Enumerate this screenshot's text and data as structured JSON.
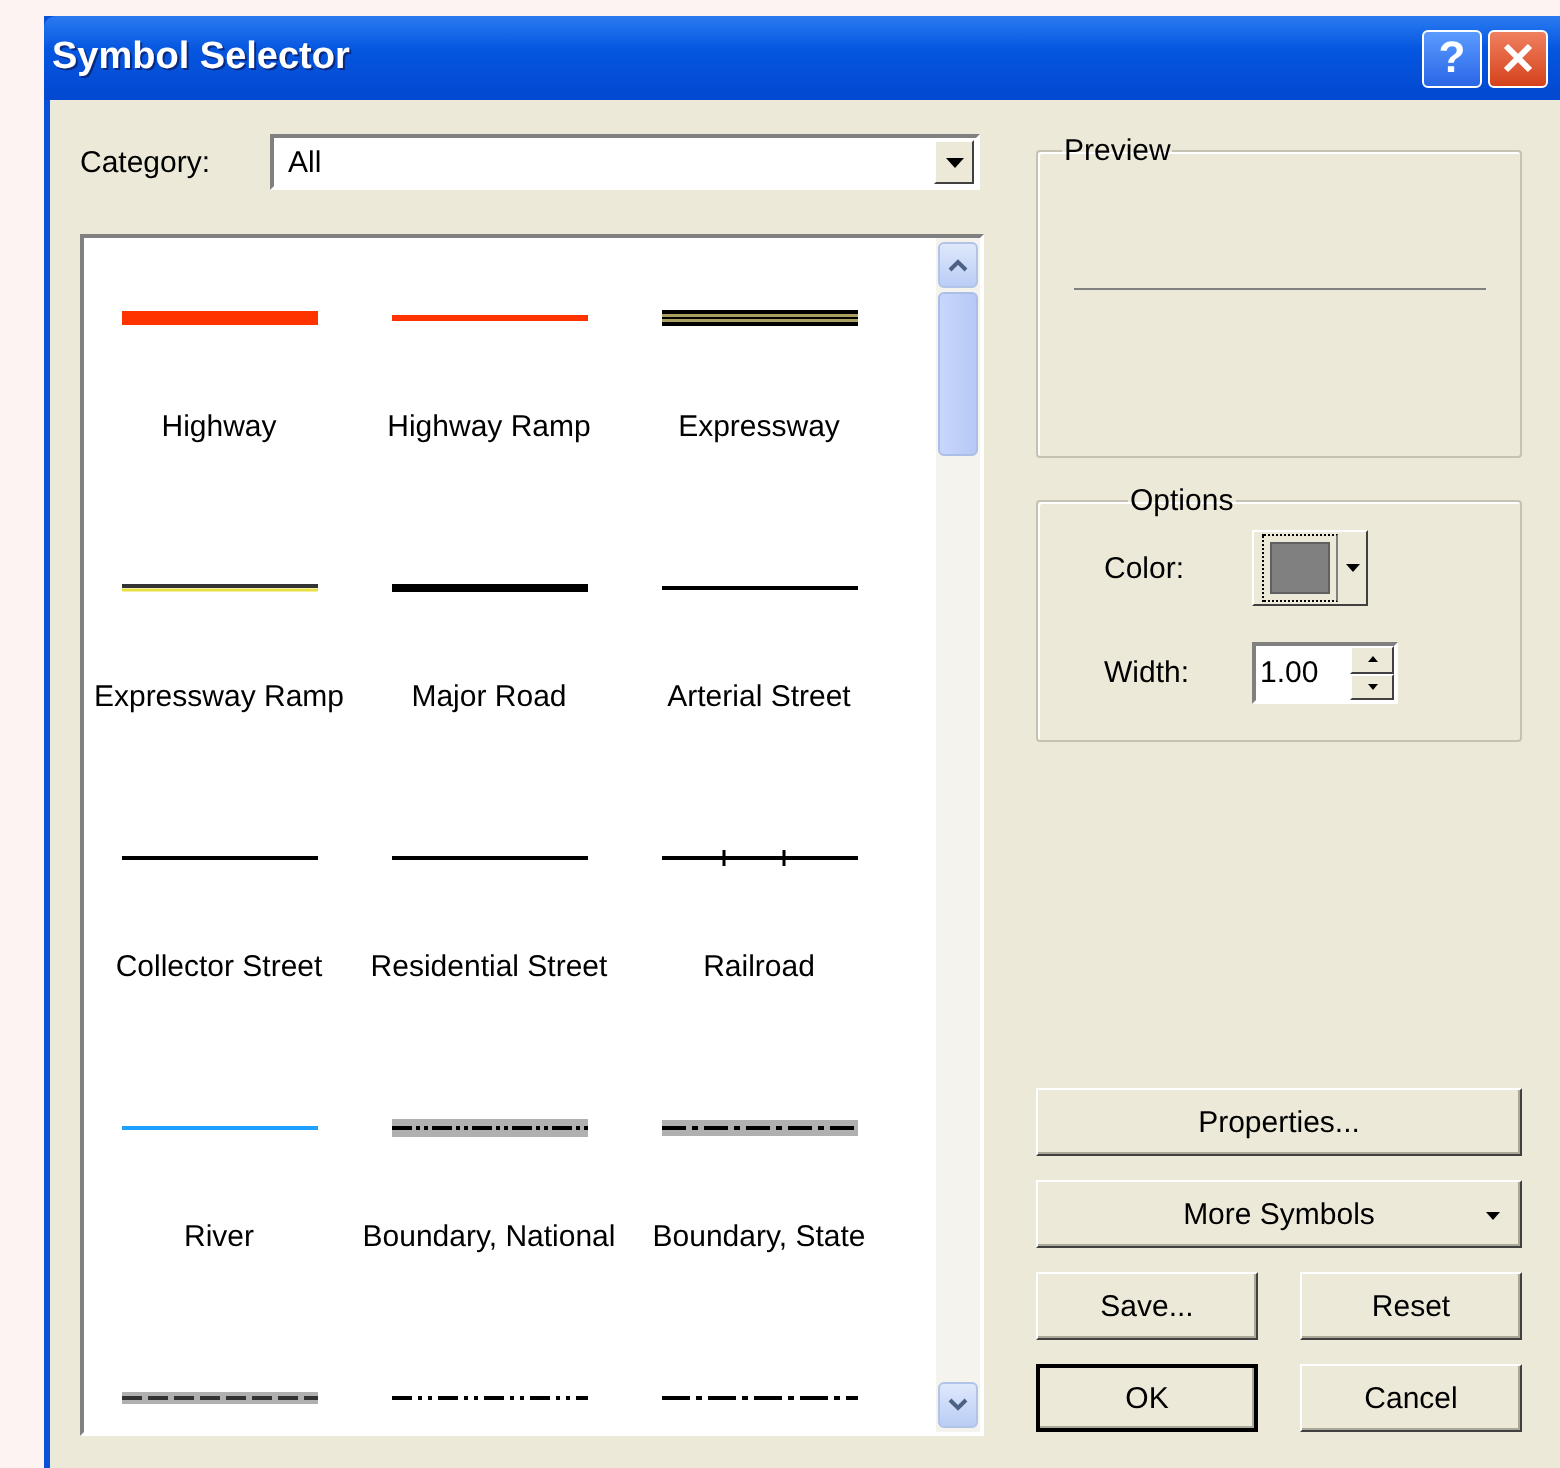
{
  "window": {
    "title": "Symbol Selector"
  },
  "title_buttons": [
    {
      "kind": "help",
      "label": "?"
    },
    {
      "kind": "close"
    }
  ],
  "category": {
    "label": "Category:",
    "value": "All"
  },
  "symbols": [
    {
      "label": "Highway",
      "kind": "wide",
      "color": "#ff3300"
    },
    {
      "label": "Highway Ramp",
      "kind": "medium",
      "color": "#ff3300"
    },
    {
      "label": "Expressway",
      "kind": "triple",
      "color": "#a8a060"
    },
    {
      "label": "Expressway Ramp",
      "kind": "cased",
      "color": "#e8e040"
    },
    {
      "label": "Major Road",
      "kind": "bold",
      "color": "#000000"
    },
    {
      "label": "Arterial Street",
      "kind": "thin",
      "color": "#000000"
    },
    {
      "label": "Collector Street",
      "kind": "thin",
      "color": "#000000"
    },
    {
      "label": "Residential Street",
      "kind": "thin",
      "color": "#000000"
    },
    {
      "label": "Railroad",
      "kind": "railroad",
      "color": "#000000"
    },
    {
      "label": "River",
      "kind": "thin",
      "color": "#1ea0ff"
    },
    {
      "label": "Boundary, National",
      "kind": "halo-dash-dot-dot",
      "color": "#b0b0b0"
    },
    {
      "label": "Boundary, State",
      "kind": "halo-dash-dot",
      "color": "#b0b0b0"
    },
    {
      "kind": "halo-dash",
      "color": "#b0b0b0"
    },
    {
      "kind": "dash-dot-dot",
      "color": "#000000"
    },
    {
      "kind": "dash-dot",
      "color": "#000000"
    }
  ],
  "preview": {
    "title": "Preview"
  },
  "options": {
    "title": "Options",
    "color_label": "Color:",
    "color": "#808080",
    "width_label": "Width:",
    "width_value": "1.00"
  },
  "buttons": [
    {
      "kind": "wide",
      "label": "Properties..."
    },
    {
      "kind": "menu",
      "label": "More Symbols"
    },
    {
      "kind": "small",
      "label": "Save..."
    },
    {
      "kind": "small",
      "label": "Reset"
    },
    {
      "kind": "default",
      "label": "OK"
    },
    {
      "kind": "small",
      "label": "Cancel"
    }
  ]
}
